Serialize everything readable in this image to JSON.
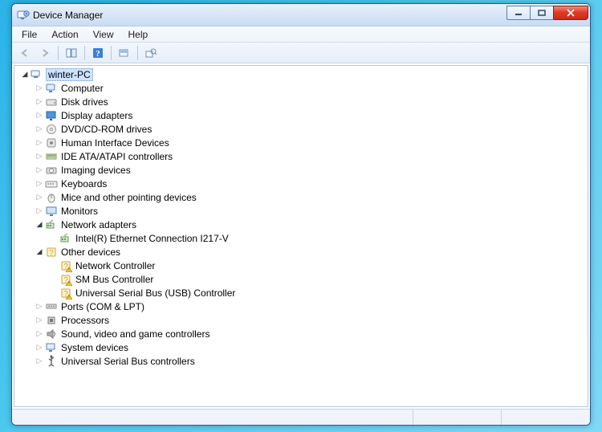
{
  "window": {
    "title": "Device Manager"
  },
  "menu": {
    "file": "File",
    "action": "Action",
    "view": "View",
    "help": "Help"
  },
  "tree": {
    "root": "winter-PC",
    "items": [
      {
        "label": "Computer",
        "icon": "computer",
        "children": []
      },
      {
        "label": "Disk drives",
        "icon": "disk",
        "children": []
      },
      {
        "label": "Display adapters",
        "icon": "display",
        "children": []
      },
      {
        "label": "DVD/CD-ROM drives",
        "icon": "dvd",
        "children": []
      },
      {
        "label": "Human Interface Devices",
        "icon": "hid",
        "children": []
      },
      {
        "label": "IDE ATA/ATAPI controllers",
        "icon": "ide",
        "children": []
      },
      {
        "label": "Imaging devices",
        "icon": "imaging",
        "children": []
      },
      {
        "label": "Keyboards",
        "icon": "keyboard",
        "children": []
      },
      {
        "label": "Mice and other pointing devices",
        "icon": "mouse",
        "children": []
      },
      {
        "label": "Monitors",
        "icon": "monitor",
        "children": []
      },
      {
        "label": "Network adapters",
        "icon": "network",
        "expanded": true,
        "children": [
          {
            "label": "Intel(R) Ethernet Connection I217-V",
            "icon": "network"
          }
        ]
      },
      {
        "label": "Other devices",
        "icon": "other",
        "expanded": true,
        "children": [
          {
            "label": "Network Controller",
            "icon": "warn"
          },
          {
            "label": "SM Bus Controller",
            "icon": "warn"
          },
          {
            "label": "Universal Serial Bus (USB) Controller",
            "icon": "warn"
          }
        ]
      },
      {
        "label": "Ports (COM & LPT)",
        "icon": "ports",
        "children": []
      },
      {
        "label": "Processors",
        "icon": "cpu",
        "children": []
      },
      {
        "label": "Sound, video and game controllers",
        "icon": "sound",
        "children": []
      },
      {
        "label": "System devices",
        "icon": "system",
        "children": []
      },
      {
        "label": "Universal Serial Bus controllers",
        "icon": "usb",
        "children": []
      }
    ]
  },
  "icons": {
    "expand_closed": "▷",
    "expand_open": "◢"
  }
}
